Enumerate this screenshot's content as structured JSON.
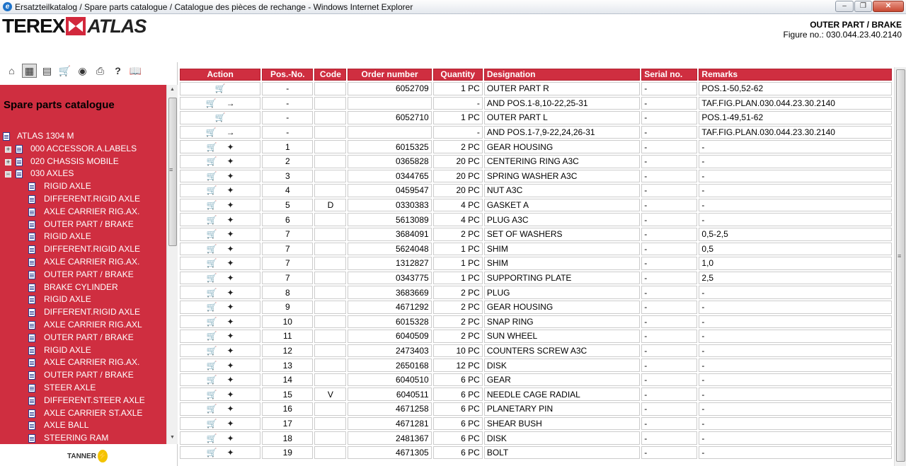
{
  "window": {
    "title": "Ersatzteilkatalog / Spare parts catalogue / Catalogue des pièces de rechange - Windows Internet Explorer"
  },
  "header": {
    "part_title": "OUTER PART / BRAKE",
    "figure": "Figure no.: 030.044.23.40.2140",
    "logo_left": "TEREX",
    "logo_right": "ATLAS"
  },
  "toolbar": {
    "icons": [
      "home-icon",
      "catalogue-grid-icon",
      "split-view-icon",
      "cart-icon",
      "binoculars-icon",
      "print-icon",
      "help-icon",
      "book-icon"
    ]
  },
  "sidebar": {
    "title": "Spare parts catalogue",
    "tree": [
      {
        "label": "ATLAS 1304 M",
        "level": 0,
        "expander": ""
      },
      {
        "label": "000 ACCESSOR.A.LABELS",
        "level": 1,
        "expander": "+"
      },
      {
        "label": "020 CHASSIS MOBILE",
        "level": 1,
        "expander": "+"
      },
      {
        "label": "030 AXLES",
        "level": 1,
        "expander": "-"
      },
      {
        "label": "RIGID AXLE",
        "level": 2,
        "expander": ""
      },
      {
        "label": "DIFFERENT.RIGID AXLE",
        "level": 2,
        "expander": ""
      },
      {
        "label": "AXLE CARRIER RIG.AX.",
        "level": 2,
        "expander": ""
      },
      {
        "label": "OUTER PART / BRAKE",
        "level": 2,
        "expander": ""
      },
      {
        "label": "RIGID AXLE",
        "level": 2,
        "expander": ""
      },
      {
        "label": "DIFFERENT.RIGID AXLE",
        "level": 2,
        "expander": ""
      },
      {
        "label": "AXLE CARRIER RIG.AX.",
        "level": 2,
        "expander": ""
      },
      {
        "label": "OUTER PART / BRAKE",
        "level": 2,
        "expander": ""
      },
      {
        "label": "BRAKE CYLINDER",
        "level": 2,
        "expander": ""
      },
      {
        "label": "RIGID AXLE",
        "level": 2,
        "expander": ""
      },
      {
        "label": "DIFFERENT.RIGID AXLE",
        "level": 2,
        "expander": ""
      },
      {
        "label": "AXLE CARRIER RIG.AXL",
        "level": 2,
        "expander": ""
      },
      {
        "label": "OUTER PART / BRAKE",
        "level": 2,
        "expander": ""
      },
      {
        "label": "RIGID AXLE",
        "level": 2,
        "expander": ""
      },
      {
        "label": "AXLE CARRIER RIG.AX.",
        "level": 2,
        "expander": ""
      },
      {
        "label": "OUTER PART / BRAKE",
        "level": 2,
        "expander": ""
      },
      {
        "label": "STEER AXLE",
        "level": 2,
        "expander": ""
      },
      {
        "label": "DIFFERENT.STEER AXLE",
        "level": 2,
        "expander": ""
      },
      {
        "label": "AXLE CARRIER ST.AXLE",
        "level": 2,
        "expander": ""
      },
      {
        "label": "AXLE BALL",
        "level": 2,
        "expander": ""
      },
      {
        "label": "STEERING RAM",
        "level": 2,
        "expander": ""
      }
    ],
    "footer_logo": "TANNER"
  },
  "table": {
    "columns": [
      "Action",
      "Pos.-No.",
      "Code",
      "Order number",
      "Quantity",
      "Designation",
      "Serial no.",
      "Remarks"
    ],
    "rows": [
      {
        "action": "cart",
        "pos": "-",
        "code": "",
        "order": "6052709",
        "qty": "1 PC",
        "designation": "OUTER PART R",
        "serial": "-",
        "remarks": "POS.1-50,52-62"
      },
      {
        "action": "cart-arrow",
        "pos": "-",
        "code": "",
        "order": "",
        "qty": "-",
        "designation": "AND POS.1-8,10-22,25-31",
        "serial": "-",
        "remarks": "TAF.FIG.PLAN.030.044.23.30.2140"
      },
      {
        "action": "cart",
        "pos": "-",
        "code": "",
        "order": "6052710",
        "qty": "1 PC",
        "designation": "OUTER PART L",
        "serial": "-",
        "remarks": "POS.1-49,51-62"
      },
      {
        "action": "cart-arrow",
        "pos": "-",
        "code": "",
        "order": "",
        "qty": "-",
        "designation": "AND POS.1-7,9-22,24,26-31",
        "serial": "-",
        "remarks": "TAF.FIG.PLAN.030.044.23.30.2140"
      },
      {
        "action": "cart-pick",
        "pos": "1",
        "code": "",
        "order": "6015325",
        "qty": "2 PC",
        "designation": "GEAR HOUSING",
        "serial": "-",
        "remarks": "-"
      },
      {
        "action": "cart-pick",
        "pos": "2",
        "code": "",
        "order": "0365828",
        "qty": "20 PC",
        "designation": "CENTERING RING A3C",
        "serial": "-",
        "remarks": "-"
      },
      {
        "action": "cart-pick",
        "pos": "3",
        "code": "",
        "order": "0344765",
        "qty": "20 PC",
        "designation": "SPRING WASHER A3C",
        "serial": "-",
        "remarks": "-"
      },
      {
        "action": "cart-pick",
        "pos": "4",
        "code": "",
        "order": "0459547",
        "qty": "20 PC",
        "designation": "NUT A3C",
        "serial": "-",
        "remarks": "-"
      },
      {
        "action": "cart-pick",
        "pos": "5",
        "code": "D",
        "order": "0330383",
        "qty": "4 PC",
        "designation": "GASKET A",
        "serial": "-",
        "remarks": "-"
      },
      {
        "action": "cart-pick",
        "pos": "6",
        "code": "",
        "order": "5613089",
        "qty": "4 PC",
        "designation": "PLUG A3C",
        "serial": "-",
        "remarks": "-"
      },
      {
        "action": "cart-pick",
        "pos": "7",
        "code": "",
        "order": "3684091",
        "qty": "2 PC",
        "designation": "SET OF WASHERS",
        "serial": "-",
        "remarks": "0,5-2,5"
      },
      {
        "action": "cart-pick",
        "pos": "7",
        "code": "",
        "order": "5624048",
        "qty": "1 PC",
        "designation": "SHIM",
        "serial": "-",
        "remarks": "0,5"
      },
      {
        "action": "cart-pick",
        "pos": "7",
        "code": "",
        "order": "1312827",
        "qty": "1 PC",
        "designation": "SHIM",
        "serial": "-",
        "remarks": "1,0"
      },
      {
        "action": "cart-pick",
        "pos": "7",
        "code": "",
        "order": "0343775",
        "qty": "1 PC",
        "designation": "SUPPORTING PLATE",
        "serial": "-",
        "remarks": "2,5"
      },
      {
        "action": "cart-pick",
        "pos": "8",
        "code": "",
        "order": "3683669",
        "qty": "2 PC",
        "designation": "PLUG",
        "serial": "-",
        "remarks": "-"
      },
      {
        "action": "cart-pick",
        "pos": "9",
        "code": "",
        "order": "4671292",
        "qty": "2 PC",
        "designation": "GEAR HOUSING",
        "serial": "-",
        "remarks": "-"
      },
      {
        "action": "cart-pick",
        "pos": "10",
        "code": "",
        "order": "6015328",
        "qty": "2 PC",
        "designation": "SNAP RING",
        "serial": "-",
        "remarks": "-"
      },
      {
        "action": "cart-pick",
        "pos": "11",
        "code": "",
        "order": "6040509",
        "qty": "2 PC",
        "designation": "SUN WHEEL",
        "serial": "-",
        "remarks": "-"
      },
      {
        "action": "cart-pick",
        "pos": "12",
        "code": "",
        "order": "2473403",
        "qty": "10 PC",
        "designation": "COUNTERS SCREW A3C",
        "serial": "-",
        "remarks": "-"
      },
      {
        "action": "cart-pick",
        "pos": "13",
        "code": "",
        "order": "2650168",
        "qty": "12 PC",
        "designation": "DISK",
        "serial": "-",
        "remarks": "-"
      },
      {
        "action": "cart-pick",
        "pos": "14",
        "code": "",
        "order": "6040510",
        "qty": "6 PC",
        "designation": "GEAR",
        "serial": "-",
        "remarks": "-"
      },
      {
        "action": "cart-pick",
        "pos": "15",
        "code": "V",
        "order": "6040511",
        "qty": "6 PC",
        "designation": "NEEDLE CAGE RADIAL",
        "serial": "-",
        "remarks": "-"
      },
      {
        "action": "cart-pick",
        "pos": "16",
        "code": "",
        "order": "4671258",
        "qty": "6 PC",
        "designation": "PLANETARY PIN",
        "serial": "-",
        "remarks": "-"
      },
      {
        "action": "cart-pick",
        "pos": "17",
        "code": "",
        "order": "4671281",
        "qty": "6 PC",
        "designation": "SHEAR BUSH",
        "serial": "-",
        "remarks": "-"
      },
      {
        "action": "cart-pick",
        "pos": "18",
        "code": "",
        "order": "2481367",
        "qty": "6 PC",
        "designation": "DISK",
        "serial": "-",
        "remarks": "-"
      },
      {
        "action": "cart-pick",
        "pos": "19",
        "code": "",
        "order": "4671305",
        "qty": "6 PC",
        "designation": "BOLT",
        "serial": "-",
        "remarks": "-"
      }
    ]
  },
  "colors": {
    "brand_red": "#cf2e40"
  }
}
